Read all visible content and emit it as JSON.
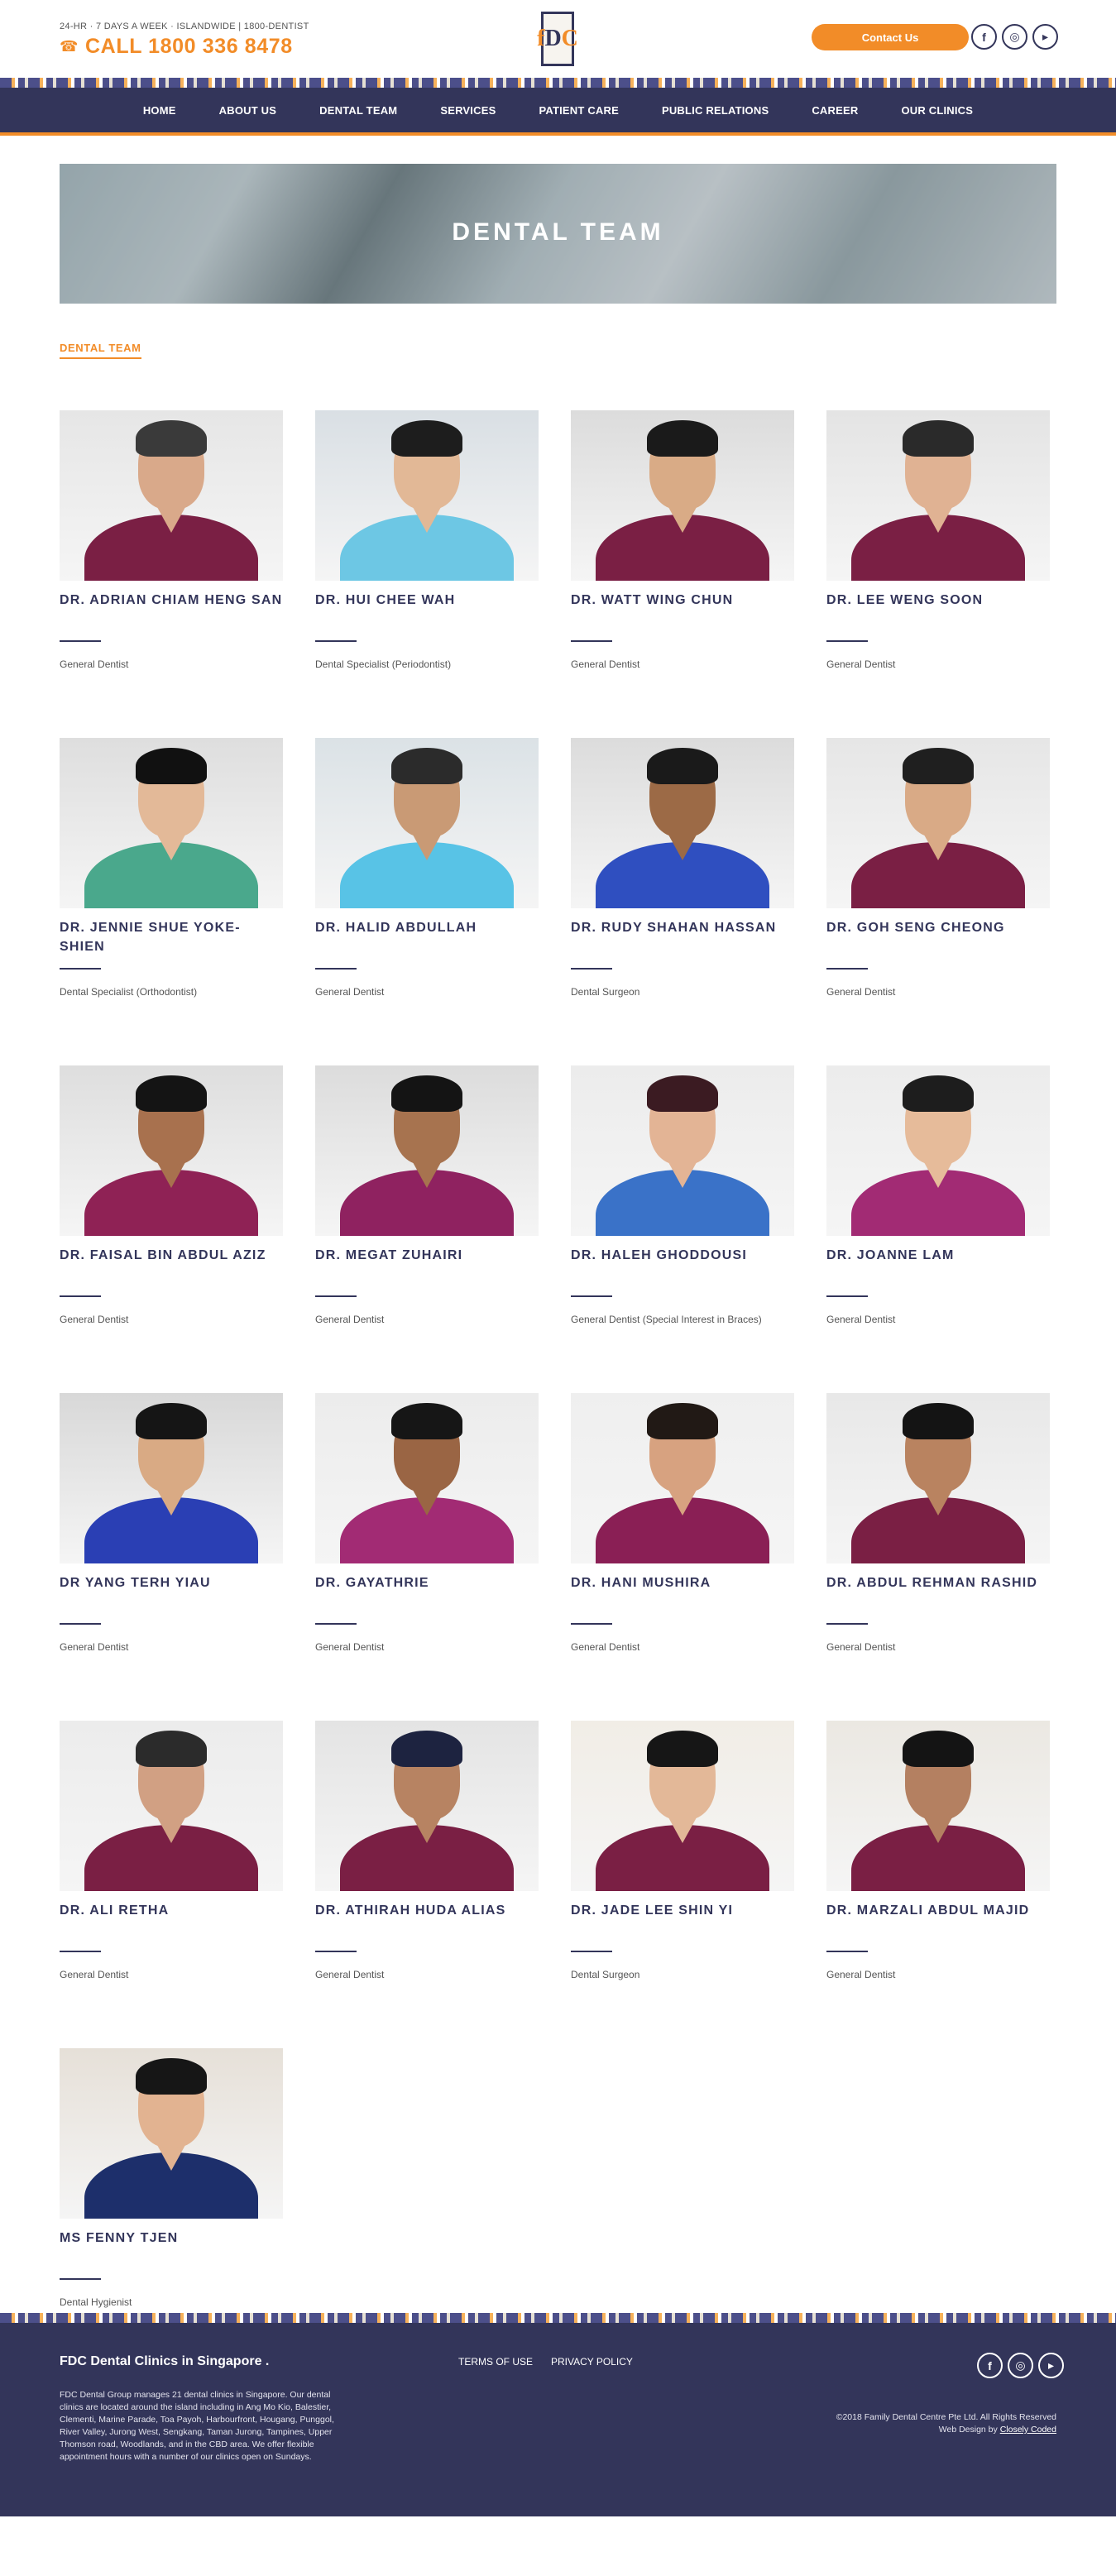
{
  "header": {
    "tagline": "24-HR · 7 DAYS A WEEK · ISLANDWIDE | 1800-DENTIST",
    "phone": "CALL 1800 336 8478",
    "logo_text": "fDC",
    "contact_label": "Contact Us",
    "socials": [
      "facebook-icon",
      "instagram-icon",
      "youtube-icon"
    ]
  },
  "nav": {
    "items": [
      "HOME",
      "ABOUT US",
      "DENTAL TEAM",
      "SERVICES",
      "PATIENT CARE",
      "PUBLIC RELATIONS",
      "CAREER",
      "OUR CLINICS"
    ]
  },
  "hero": {
    "title": "DENTAL TEAM"
  },
  "section_label": "DENTAL TEAM",
  "team": [
    {
      "name": "DR. ADRIAN CHIAM HENG SAN",
      "role": "General Dentist",
      "scrub": "#7a1f44",
      "skin": "#d9a98a",
      "hair": "#3a3a3a",
      "bg": "#e6e6e6"
    },
    {
      "name": "DR. HUI CHEE WAH",
      "role": "Dental Specialist (Periodontist)",
      "scrub": "#6dc7e4",
      "skin": "#e2b896",
      "hair": "#1d1d1d",
      "bg": "#d9dfe4"
    },
    {
      "name": "DR. WATT WING CHUN",
      "role": "General Dentist",
      "scrub": "#7a1f44",
      "skin": "#d9ab86",
      "hair": "#1a1a1a",
      "bg": "#dcdcdc"
    },
    {
      "name": "DR. LEE WENG SOON",
      "role": "General Dentist",
      "scrub": "#7a1f44",
      "skin": "#e0b293",
      "hair": "#2a2a2a",
      "bg": "#e4e4e4"
    },
    {
      "name": "DR. JENNIE SHUE YOKE-SHIEN",
      "role": "Dental Specialist (Orthodontist)",
      "scrub": "#4aa88c",
      "skin": "#e3b998",
      "hair": "#111111",
      "bg": "#dedede"
    },
    {
      "name": "DR. HALID ABDULLAH",
      "role": "General Dentist",
      "scrub": "#58c3e6",
      "skin": "#c99a75",
      "hair": "#2b2b2b",
      "bg": "#dbe2e6"
    },
    {
      "name": "DR. RUDY SHAHAN HASSAN",
      "role": "Dental Surgeon",
      "scrub": "#2f4fc0",
      "skin": "#9c6a46",
      "hair": "#1a1a1a",
      "bg": "#dcdcdc"
    },
    {
      "name": "DR. GOH SENG CHEONG",
      "role": "General Dentist",
      "scrub": "#7a1f44",
      "skin": "#d9aa86",
      "hair": "#1f1f1f",
      "bg": "#e6e6e6"
    },
    {
      "name": "DR. FAISAL BIN ABDUL AZIZ",
      "role": "General Dentist",
      "scrub": "#8f2255",
      "skin": "#a8714e",
      "hair": "#141414",
      "bg": "#dedede"
    },
    {
      "name": "DR. MEGAT ZUHAIRI",
      "role": "General Dentist",
      "scrub": "#8f2260",
      "skin": "#a7734f",
      "hair": "#141414",
      "bg": "#dcdcdc"
    },
    {
      "name": "DR. HALEH GHODDOUSI",
      "role": "General Dentist (Special Interest in Braces)",
      "scrub": "#3a72c8",
      "skin": "#e3b495",
      "hair": "#3b1b22",
      "bg": "#ececec"
    },
    {
      "name": "DR. JOANNE LAM",
      "role": "General Dentist",
      "scrub": "#a22b74",
      "skin": "#e6bb9a",
      "hair": "#1d1d1d",
      "bg": "#ececec"
    },
    {
      "name": "DR YANG TERH YIAU",
      "role": "General Dentist",
      "scrub": "#2a3fb4",
      "skin": "#d9aa84",
      "hair": "#151515",
      "bg": "#d8d8d8"
    },
    {
      "name": "DR. GAYATHRIE",
      "role": "General Dentist",
      "scrub": "#a22b74",
      "skin": "#9a6544",
      "hair": "#161616",
      "bg": "#ececec"
    },
    {
      "name": "DR. HANI MUSHIRA",
      "role": "General Dentist",
      "scrub": "#8a1f55",
      "skin": "#d7a280",
      "hair": "#211915",
      "bg": "#efefef"
    },
    {
      "name": "DR. ABDUL REHMAN RASHID",
      "role": "General Dentist",
      "scrub": "#7a1f44",
      "skin": "#b98360",
      "hair": "#141414",
      "bg": "#e8e8e8"
    },
    {
      "name": "DR. ALI RETHA",
      "role": "General Dentist",
      "scrub": "#7a1f44",
      "skin": "#d1a083",
      "hair": "#2b2b2b",
      "bg": "#ececec"
    },
    {
      "name": "DR. ATHIRAH HUDA ALIAS",
      "role": "General Dentist",
      "scrub": "#7a1f44",
      "skin": "#b78362",
      "hair": "#1d2340",
      "bg": "#e4e4e4"
    },
    {
      "name": "DR. JADE LEE SHIN YI",
      "role": "Dental Surgeon",
      "scrub": "#7a1f44",
      "skin": "#e3b898",
      "hair": "#161616",
      "bg": "#f1ede6"
    },
    {
      "name": "DR. MARZALI ABDUL MAJID",
      "role": "General Dentist",
      "scrub": "#7a1f44",
      "skin": "#b48061",
      "hair": "#141414",
      "bg": "#ebe8e2"
    },
    {
      "name": "MS FENNY TJEN",
      "role": "Dental Hygienist",
      "scrub": "#1d2f6b",
      "skin": "#e2b391",
      "hair": "#161616",
      "bg": "#e6e0d8"
    }
  ],
  "footer": {
    "title": "FDC Dental Clinics in Singapore .",
    "description": "FDC Dental Group manages 21 dental clinics in Singapore. Our dental clinics are located around the island including in Ang Mo Kio, Balestier, Clementi, Marine Parade, Toa Payoh, Harbourfront, Hougang, Punggol, River Valley, Jurong West, Sengkang, Taman Jurong, Tampines, Upper Thomson road, Woodlands, and in the CBD area. We offer flexible appointment hours with a number of our clinics open on Sundays.",
    "links": [
      "TERMS OF USE",
      "PRIVACY POLICY"
    ],
    "copyright": "©2018 Family Dental Centre Pte Ltd. All Rights Reserved",
    "credit_prefix": "Web Design by",
    "credit_link": "Closely Coded"
  },
  "colors": {
    "navy": "#33355a",
    "orange": "#f28c28"
  }
}
